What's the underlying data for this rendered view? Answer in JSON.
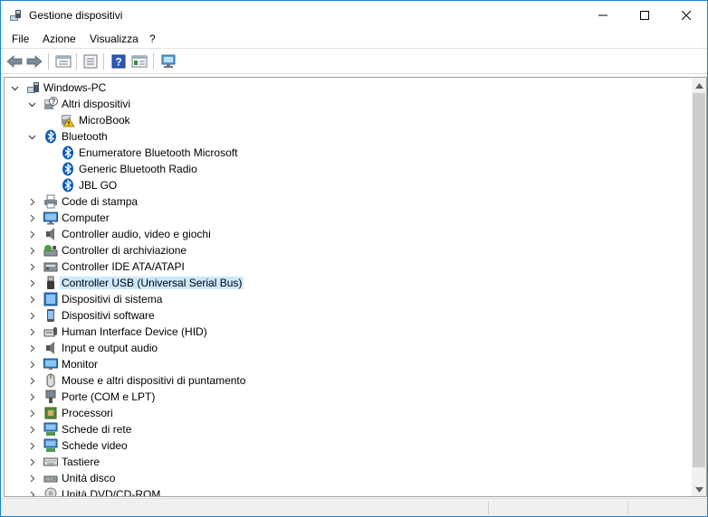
{
  "window": {
    "title": "Gestione dispositivi"
  },
  "menu": [
    "File",
    "Azione",
    "Visualizza",
    "?"
  ],
  "toolbar": [
    "back-icon",
    "forward-icon",
    "properties-icon",
    "show-hide-icon",
    "help-icon",
    "action-view-icon",
    "scan-hardware-icon"
  ],
  "tree": {
    "root": "Windows-PC",
    "nodes": [
      {
        "label": "Altri dispositivi",
        "icon": "unknown-device-icon",
        "expanded": true,
        "children": [
          {
            "label": "MicroBook",
            "icon": "warning-device-icon"
          }
        ]
      },
      {
        "label": "Bluetooth",
        "icon": "bluetooth-icon",
        "expanded": true,
        "children": [
          {
            "label": "Enumeratore Bluetooth Microsoft",
            "icon": "bluetooth-icon"
          },
          {
            "label": "Generic Bluetooth Radio",
            "icon": "bluetooth-icon"
          },
          {
            "label": "JBL GO",
            "icon": "bluetooth-icon"
          }
        ]
      },
      {
        "label": "Code di stampa",
        "icon": "print-queue-icon"
      },
      {
        "label": "Computer",
        "icon": "computer-icon"
      },
      {
        "label": "Controller audio, video e giochi",
        "icon": "speaker-icon"
      },
      {
        "label": "Controller di archiviazione",
        "icon": "storage-controller-icon"
      },
      {
        "label": "Controller IDE ATA/ATAPI",
        "icon": "ide-controller-icon"
      },
      {
        "label": "Controller USB (Universal Serial Bus)",
        "icon": "usb-icon",
        "selected": true
      },
      {
        "label": "Dispositivi di sistema",
        "icon": "system-device-icon"
      },
      {
        "label": "Dispositivi software",
        "icon": "software-device-icon"
      },
      {
        "label": "Human Interface Device (HID)",
        "icon": "hid-icon"
      },
      {
        "label": "Input e output audio",
        "icon": "audio-io-icon"
      },
      {
        "label": "Monitor",
        "icon": "monitor-icon"
      },
      {
        "label": "Mouse e altri dispositivi di puntamento",
        "icon": "mouse-icon"
      },
      {
        "label": "Porte (COM e LPT)",
        "icon": "port-icon"
      },
      {
        "label": "Processori",
        "icon": "processor-icon"
      },
      {
        "label": "Schede di rete",
        "icon": "network-adapter-icon"
      },
      {
        "label": "Schede video",
        "icon": "display-adapter-icon"
      },
      {
        "label": "Tastiere",
        "icon": "keyboard-icon"
      },
      {
        "label": "Unità disco",
        "icon": "disk-drive-icon"
      },
      {
        "label": "Unità DVD/CD-ROM",
        "icon": "dvd-drive-icon"
      }
    ]
  },
  "colors": {
    "selection": "#cce8ff",
    "border": "#1883d7",
    "bluetooth": "#0b5fb3"
  }
}
